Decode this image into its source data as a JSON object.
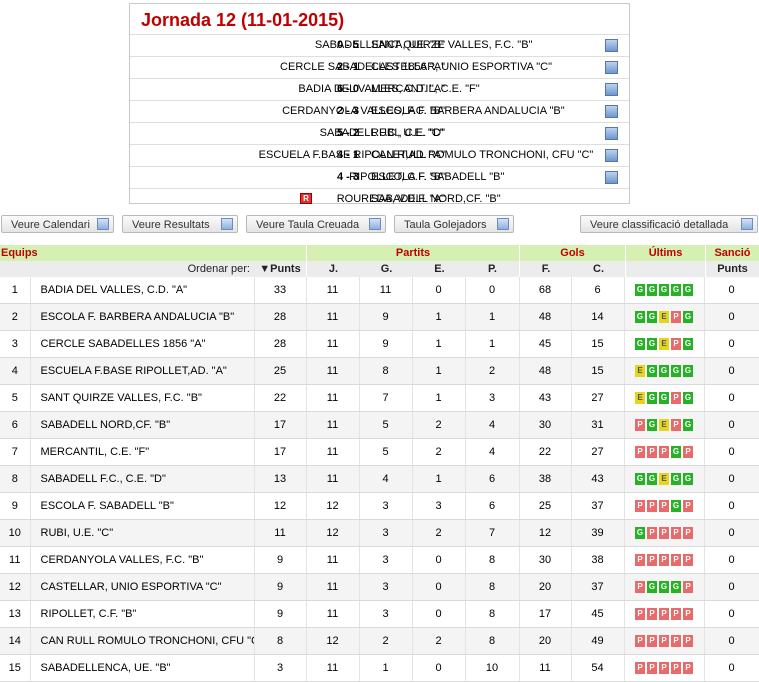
{
  "jornada": {
    "title": "Jornada 12 (11-01-2015)",
    "matches": [
      {
        "home": "SABADELLENCA, UE. \"B\"",
        "score": "0 - 5",
        "away": "SANT QUIRZE VALLES, F.C. \"B\"",
        "icon": "detail-icon"
      },
      {
        "home": "CERCLE SABADELLES 1856 \"A\"",
        "score": "2 - 1",
        "away": "CASTELLAR, UNIO ESPORTIVA \"C\"",
        "icon": "detail-icon"
      },
      {
        "home": "BADIA DEL VALLES, C.D. \"A\"",
        "score": "6 - 0",
        "away": "MERCANTIL, C.E. \"F\"",
        "icon": "detail-icon"
      },
      {
        "home": "CERDANYOLA VALLES, F.C. \"B\"",
        "score": "2 - 3",
        "away": "ESCOLA F. BARBERA ANDALUCIA \"B\"",
        "icon": "detail-icon"
      },
      {
        "home": "SABADELL F.C., C.E. \"D\"",
        "score": "5 - 2",
        "away": "RUBI, U.E. \"C\"",
        "icon": "detail-icon"
      },
      {
        "home": "ESCUELA F.BASE RIPOLLET,AD. \"A\"",
        "score": "4 - 1",
        "away": "CAN RULL ROMULO TRONCHONI, CFU \"C\"",
        "icon": "detail-icon"
      },
      {
        "home": "RIPOLLET, C.F. \"B\"",
        "score": "4 - 3",
        "away": "ESCOLA F. SABADELL \"B\"",
        "icon": "detail-icon"
      },
      {
        "home": "ROUREDA, V.D.F. \"A\"",
        "score": "",
        "away": "SABADELL NORD,CF. \"B\"",
        "icon": "",
        "rest_badge": "R"
      }
    ]
  },
  "toolbar": {
    "calendar": "Veure Calendari",
    "results": "Veure Resultats",
    "cross_table": "Veure Taula Creuada",
    "scorers": "Taula Golejadors",
    "detailed": "Veure classificació detallada"
  },
  "headers": {
    "teams": "Equips",
    "matches": "Partits",
    "goals": "Gols",
    "last": "Últims",
    "sanction": "Sanció",
    "order_by": "Ordenar per:",
    "points": "Punts",
    "j": "J.",
    "g": "G.",
    "e": "E.",
    "p": "P.",
    "f": "F.",
    "c": "C.",
    "sanction_points": "Punts",
    "sort_icon": "sort-down-icon"
  },
  "colors": {
    "title": "#c00000",
    "group_header_bg": "#d6f0b4",
    "win": "#26b126",
    "draw": "#e5d61c",
    "loss": "#e86a6a"
  },
  "standings": [
    {
      "pos": "1",
      "team": "BADIA DEL VALLES, C.D. \"A\"",
      "pts": "33",
      "j": "11",
      "g": "11",
      "e": "0",
      "p": "0",
      "f": "68",
      "c": "6",
      "last": [
        "G",
        "G",
        "G",
        "G",
        "G"
      ],
      "sanc": "0"
    },
    {
      "pos": "2",
      "team": "ESCOLA F. BARBERA ANDALUCIA \"B\"",
      "pts": "28",
      "j": "11",
      "g": "9",
      "e": "1",
      "p": "1",
      "f": "48",
      "c": "14",
      "last": [
        "G",
        "G",
        "E",
        "P",
        "G"
      ],
      "sanc": "0"
    },
    {
      "pos": "3",
      "team": "CERCLE SABADELLES 1856 \"A\"",
      "pts": "28",
      "j": "11",
      "g": "9",
      "e": "1",
      "p": "1",
      "f": "45",
      "c": "15",
      "last": [
        "G",
        "G",
        "E",
        "P",
        "G"
      ],
      "sanc": "0"
    },
    {
      "pos": "4",
      "team": "ESCUELA F.BASE RIPOLLET,AD. \"A\"",
      "pts": "25",
      "j": "11",
      "g": "8",
      "e": "1",
      "p": "2",
      "f": "48",
      "c": "15",
      "last": [
        "E",
        "G",
        "G",
        "G",
        "G"
      ],
      "sanc": "0"
    },
    {
      "pos": "5",
      "team": "SANT QUIRZE VALLES, F.C. \"B\"",
      "pts": "22",
      "j": "11",
      "g": "7",
      "e": "1",
      "p": "3",
      "f": "43",
      "c": "27",
      "last": [
        "E",
        "G",
        "G",
        "P",
        "G"
      ],
      "sanc": "0"
    },
    {
      "pos": "6",
      "team": "SABADELL NORD,CF. \"B\"",
      "pts": "17",
      "j": "11",
      "g": "5",
      "e": "2",
      "p": "4",
      "f": "30",
      "c": "31",
      "last": [
        "P",
        "G",
        "E",
        "P",
        "G"
      ],
      "sanc": "0"
    },
    {
      "pos": "7",
      "team": "MERCANTIL, C.E. \"F\"",
      "pts": "17",
      "j": "11",
      "g": "5",
      "e": "2",
      "p": "4",
      "f": "22",
      "c": "27",
      "last": [
        "P",
        "P",
        "P",
        "G",
        "P"
      ],
      "sanc": "0"
    },
    {
      "pos": "8",
      "team": "SABADELL F.C., C.E. \"D\"",
      "pts": "13",
      "j": "11",
      "g": "4",
      "e": "1",
      "p": "6",
      "f": "38",
      "c": "43",
      "last": [
        "G",
        "G",
        "E",
        "G",
        "G"
      ],
      "sanc": "0"
    },
    {
      "pos": "9",
      "team": "ESCOLA F. SABADELL \"B\"",
      "pts": "12",
      "j": "12",
      "g": "3",
      "e": "3",
      "p": "6",
      "f": "25",
      "c": "37",
      "last": [
        "P",
        "P",
        "P",
        "G",
        "P"
      ],
      "sanc": "0"
    },
    {
      "pos": "10",
      "team": "RUBI, U.E. \"C\"",
      "pts": "11",
      "j": "12",
      "g": "3",
      "e": "2",
      "p": "7",
      "f": "12",
      "c": "39",
      "last": [
        "G",
        "P",
        "P",
        "P",
        "P"
      ],
      "sanc": "0"
    },
    {
      "pos": "11",
      "team": "CERDANYOLA VALLES, F.C. \"B\"",
      "pts": "9",
      "j": "11",
      "g": "3",
      "e": "0",
      "p": "8",
      "f": "30",
      "c": "38",
      "last": [
        "P",
        "P",
        "P",
        "P",
        "P"
      ],
      "sanc": "0"
    },
    {
      "pos": "12",
      "team": "CASTELLAR, UNIO ESPORTIVA \"C\"",
      "pts": "9",
      "j": "11",
      "g": "3",
      "e": "0",
      "p": "8",
      "f": "20",
      "c": "37",
      "last": [
        "P",
        "G",
        "G",
        "G",
        "P"
      ],
      "sanc": "0"
    },
    {
      "pos": "13",
      "team": "RIPOLLET, C.F. \"B\"",
      "pts": "9",
      "j": "11",
      "g": "3",
      "e": "0",
      "p": "8",
      "f": "17",
      "c": "45",
      "last": [
        "P",
        "P",
        "P",
        "P",
        "P"
      ],
      "sanc": "0"
    },
    {
      "pos": "14",
      "team": "CAN RULL ROMULO TRONCHONI, CFU \"C\"",
      "pts": "8",
      "j": "12",
      "g": "2",
      "e": "2",
      "p": "8",
      "f": "20",
      "c": "49",
      "last": [
        "P",
        "P",
        "P",
        "P",
        "P"
      ],
      "sanc": "0"
    },
    {
      "pos": "15",
      "team": "SABADELLENCA, UE. \"B\"",
      "pts": "3",
      "j": "11",
      "g": "1",
      "e": "0",
      "p": "10",
      "f": "11",
      "c": "54",
      "last": [
        "P",
        "P",
        "P",
        "P",
        "P"
      ],
      "sanc": "0"
    }
  ]
}
